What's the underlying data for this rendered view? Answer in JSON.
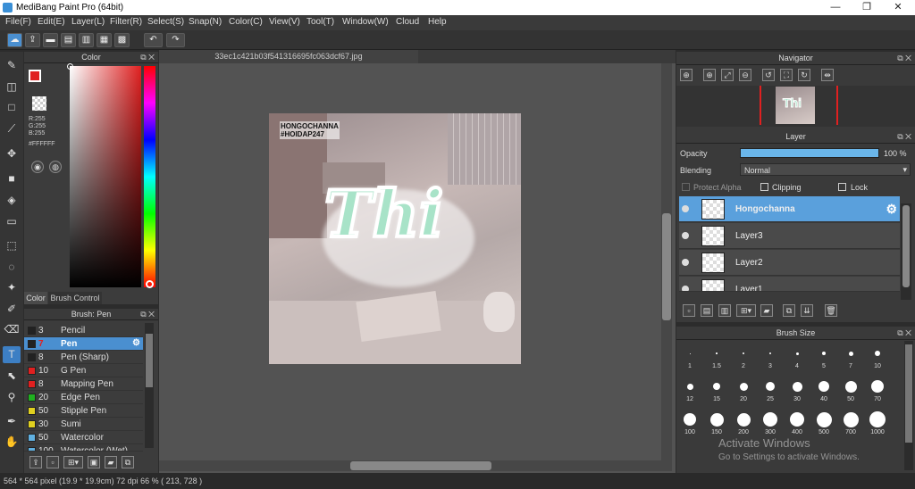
{
  "window": {
    "title": "MediBang Paint Pro (64bit)",
    "min": "—",
    "max": "❐",
    "close": "✕"
  },
  "menu": [
    "File(F)",
    "Edit(E)",
    "Layer(L)",
    "Filter(R)",
    "Select(S)",
    "Snap(N)",
    "Color(C)",
    "View(V)",
    "Tool(T)",
    "Window(W)",
    "Cloud",
    "Help"
  ],
  "color_panel": {
    "title": "Color",
    "rgb_r": "R:255",
    "rgb_g": "G:255",
    "rgb_b": "B:255",
    "hex": "#FFFFFF",
    "tab_color": "Color",
    "tab_brush_control": "Brush Control",
    "primary_color": "#e02020",
    "secondary_color": "#ffffff"
  },
  "brush_panel": {
    "title": "Brush: Pen",
    "items": [
      {
        "size": "3",
        "name": "Pencil",
        "color": "#222222"
      },
      {
        "size": "7",
        "name": "Pen",
        "color": "#222222"
      },
      {
        "size": "8",
        "name": "Pen (Sharp)",
        "color": "#222222"
      },
      {
        "size": "10",
        "name": "G Pen",
        "color": "#e02020"
      },
      {
        "size": "8",
        "name": "Mapping Pen",
        "color": "#e02020"
      },
      {
        "size": "20",
        "name": "Edge Pen",
        "color": "#20b020"
      },
      {
        "size": "50",
        "name": "Stipple Pen",
        "color": "#e0d020"
      },
      {
        "size": "30",
        "name": "Sumi",
        "color": "#e0d020"
      },
      {
        "size": "50",
        "name": "Watercolor",
        "color": "#60b0e0"
      },
      {
        "size": "100",
        "name": "Watercolor (Wet)",
        "color": "#60b0e0"
      }
    ],
    "selected_index": 1
  },
  "document": {
    "tab_name": "33ec1c421b03f541316695fc063dcf67.jpg",
    "watermark_line1": "HONGOCHANNA",
    "watermark_line2": "#HOIDAP247",
    "art_text": "Thi"
  },
  "navigator": {
    "title": "Navigator"
  },
  "layer_panel": {
    "title": "Layer",
    "opacity_label": "Opacity",
    "opacity_value": "100 %",
    "opacity_fraction": 1.0,
    "blending_label": "Blending",
    "blending_value": "Normal",
    "protect_alpha": "Protect Alpha",
    "clipping": "Clipping",
    "lock": "Lock",
    "layers": [
      {
        "name": "Hongochanna",
        "selected": true
      },
      {
        "name": "Layer3",
        "selected": false
      },
      {
        "name": "Layer2",
        "selected": false
      },
      {
        "name": "Layer1",
        "selected": false
      }
    ]
  },
  "brush_size": {
    "title": "Brush Size",
    "sizes": [
      "1",
      "1.5",
      "2",
      "3",
      "4",
      "5",
      "7",
      "10",
      "12",
      "15",
      "20",
      "25",
      "30",
      "40",
      "50",
      "70",
      "100",
      "150",
      "200",
      "300",
      "400",
      "500",
      "700",
      "1000"
    ]
  },
  "activation": {
    "line1": "Activate Windows",
    "line2": "Go to Settings to activate Windows."
  },
  "status": {
    "text": "564 * 564 pixel   (19.9 * 19.9cm)   72 dpi   66 %   ( 213, 728 )"
  }
}
